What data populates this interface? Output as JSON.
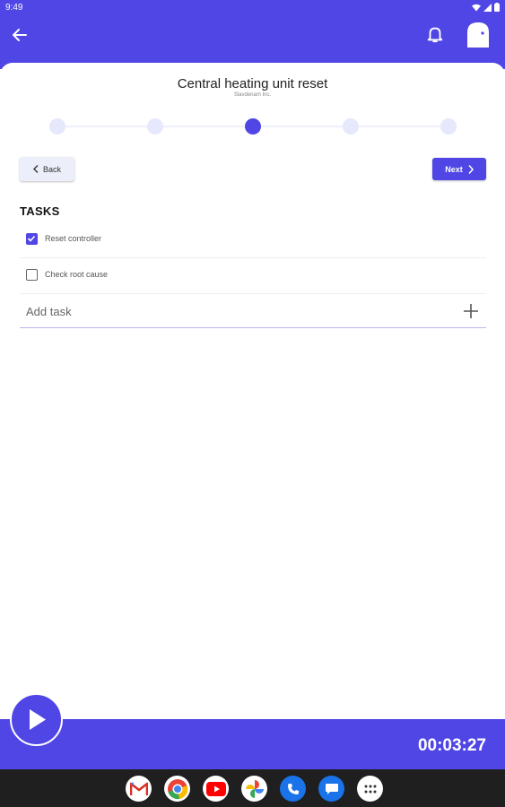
{
  "status_bar": {
    "time": "9:49"
  },
  "header": {
    "title": "Central heating unit reset",
    "subtitle": "Slavdenam Inc."
  },
  "stepper": {
    "total_steps": 5,
    "active_step": 3
  },
  "nav": {
    "back_label": "Back",
    "next_label": "Next"
  },
  "tasks": {
    "heading": "TASKS",
    "items": [
      {
        "label": "Reset controller",
        "checked": true
      },
      {
        "label": "Check root cause",
        "checked": false
      }
    ],
    "add_placeholder": "Add task"
  },
  "timer": {
    "value": "00:03:27"
  },
  "colors": {
    "accent": "#4f46e5",
    "step_inactive": "#e6e8fb",
    "nav_bar": "#1f1f1f"
  },
  "dock_apps": [
    "gmail-icon",
    "chrome-icon",
    "youtube-icon",
    "photos-icon",
    "phone-icon",
    "messages-icon",
    "app-drawer-icon"
  ]
}
